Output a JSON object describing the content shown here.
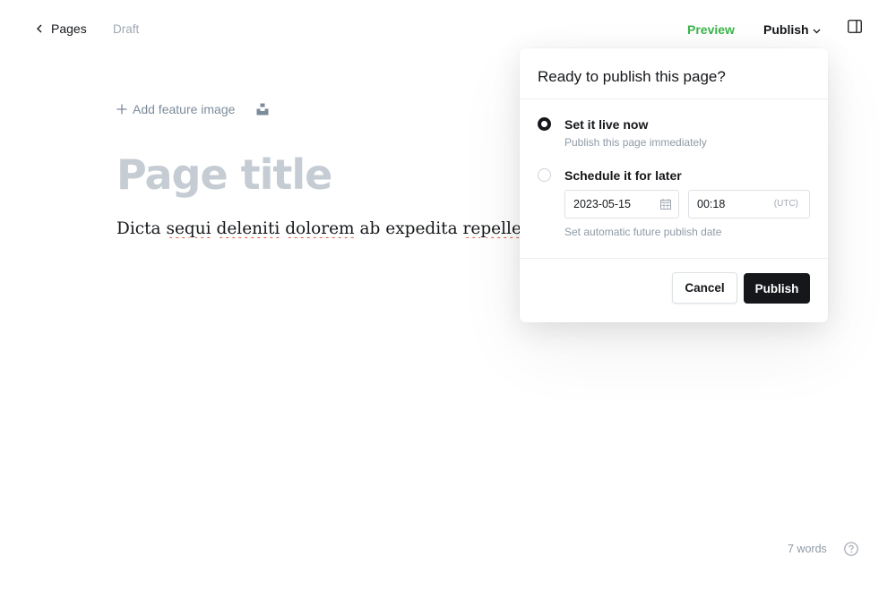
{
  "topbar": {
    "back_label": "Pages",
    "status": "Draft",
    "preview_label": "Preview",
    "publish_label": "Publish"
  },
  "editor": {
    "feature_image_label": "Add feature image",
    "title_placeholder": "Page title",
    "body_words": [
      "Dicta",
      "sequi",
      "deleniti",
      "dolorem",
      "ab",
      "expedita",
      "repellendus."
    ]
  },
  "publish_popover": {
    "title": "Ready to publish this page?",
    "options": [
      {
        "label": "Set it live now",
        "hint": "Publish this page immediately",
        "selected": true
      },
      {
        "label": "Schedule it for later",
        "hint": "Set automatic future publish date",
        "selected": false
      }
    ],
    "schedule": {
      "date": "2023-05-15",
      "time": "00:18",
      "timezone": "(UTC)"
    },
    "cancel_label": "Cancel",
    "publish_label": "Publish"
  },
  "footer": {
    "word_count": "7 words"
  },
  "colors": {
    "accent_green": "#3bb54a",
    "dark": "#15171a",
    "muted": "#8e9aa6",
    "title_placeholder": "#c5ccd3"
  }
}
